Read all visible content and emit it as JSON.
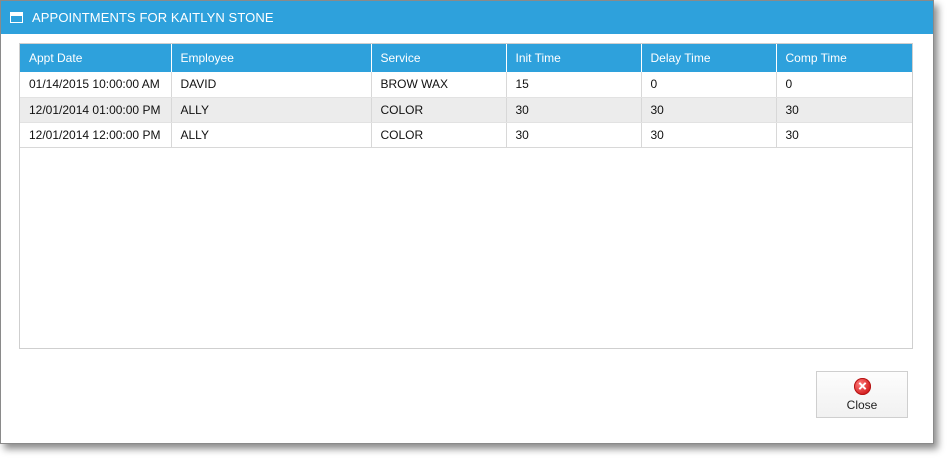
{
  "window": {
    "title": "APPOINTMENTS FOR KAITLYN STONE",
    "title_icon": "window-icon"
  },
  "grid": {
    "columns": [
      "Appt Date",
      "Employee",
      "Service",
      "Init Time",
      "Delay Time",
      "Comp Time"
    ],
    "rows": [
      [
        "01/14/2015 10:00:00 AM",
        "DAVID",
        "BROW WAX",
        "15",
        "0",
        "0"
      ],
      [
        "12/01/2014 01:00:00 PM",
        "ALLY",
        "COLOR",
        "30",
        "30",
        "30"
      ],
      [
        "12/01/2014 12:00:00 PM",
        "ALLY",
        "COLOR",
        "30",
        "30",
        "30"
      ]
    ]
  },
  "actions": {
    "close_label": "Close",
    "close_icon": "close-circle-icon"
  },
  "colors": {
    "accent": "#2ea1dc",
    "alt_row": "#ececec",
    "close_icon": "#d41f1f"
  }
}
